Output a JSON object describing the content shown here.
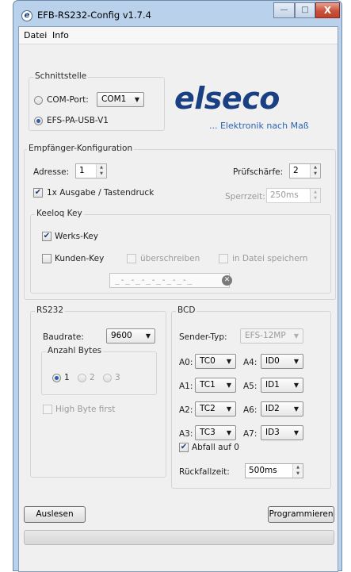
{
  "window": {
    "title": "EFB-RS232-Config v1.7.4",
    "minimize": "—",
    "maximize": "□",
    "close": "X"
  },
  "menu": {
    "items": [
      "Datei",
      "Info"
    ]
  },
  "schnittstelle": {
    "title": "Schnittstelle",
    "com_port_label": "COM-Port:",
    "com_port_value": "COM1",
    "usb_label": "EFS-PA-USB-V1",
    "selected": "usb"
  },
  "logo": {
    "name": "elseco",
    "slogan": "... Elektronik nach Maß"
  },
  "empfaenger": {
    "title": "Empfänger-Konfiguration",
    "adresse_label": "Adresse:",
    "adresse_value": "1",
    "pruefschaerfe_label": "Prüfschärfe:",
    "pruefschaerfe_value": "2",
    "ausgabe_label": "1x Ausgabe / Tastendruck",
    "ausgabe_checked": true,
    "sperrzeit_label": "Sperrzeit:",
    "sperrzeit_value": "250ms"
  },
  "keeloq": {
    "title": "Keeloq Key",
    "werks_key_label": "Werks-Key",
    "werks_key_checked": true,
    "kunden_key_label": "Kunden-Key",
    "kunden_key_checked": false,
    "ueberschreiben_label": "überschreiben",
    "in_datei_label": "in Datei speichern",
    "key_mask": "_-_-_-_-_-_-_-_"
  },
  "rs232": {
    "title": "RS232",
    "baudrate_label": "Baudrate:",
    "baudrate_value": "9600",
    "anzahl_bytes_title": "Anzahl Bytes",
    "bytes_options": [
      "1",
      "2",
      "3"
    ],
    "bytes_selected": "1",
    "high_byte_label": "High Byte first"
  },
  "bcd": {
    "title": "BCD",
    "sender_typ_label": "Sender-Typ:",
    "sender_typ_value": "EFS-12MP",
    "rows": [
      {
        "left_label": "A0:",
        "left_value": "TC0",
        "right_label": "A4:",
        "right_value": "ID0"
      },
      {
        "left_label": "A1:",
        "left_value": "TC1",
        "right_label": "A5:",
        "right_value": "ID1"
      },
      {
        "left_label": "A2:",
        "left_value": "TC2",
        "right_label": "A6:",
        "right_value": "ID2"
      },
      {
        "left_label": "A3:",
        "left_value": "TC3",
        "right_label": "A7:",
        "right_value": "ID3"
      }
    ],
    "abfall_label": "Abfall auf 0",
    "abfall_checked": true,
    "rueckfallzeit_label": "Rückfallzeit:",
    "rueckfallzeit_value": "500ms"
  },
  "buttons": {
    "auslesen": "Auslesen",
    "programmieren": "Programmieren"
  },
  "progress": 0
}
